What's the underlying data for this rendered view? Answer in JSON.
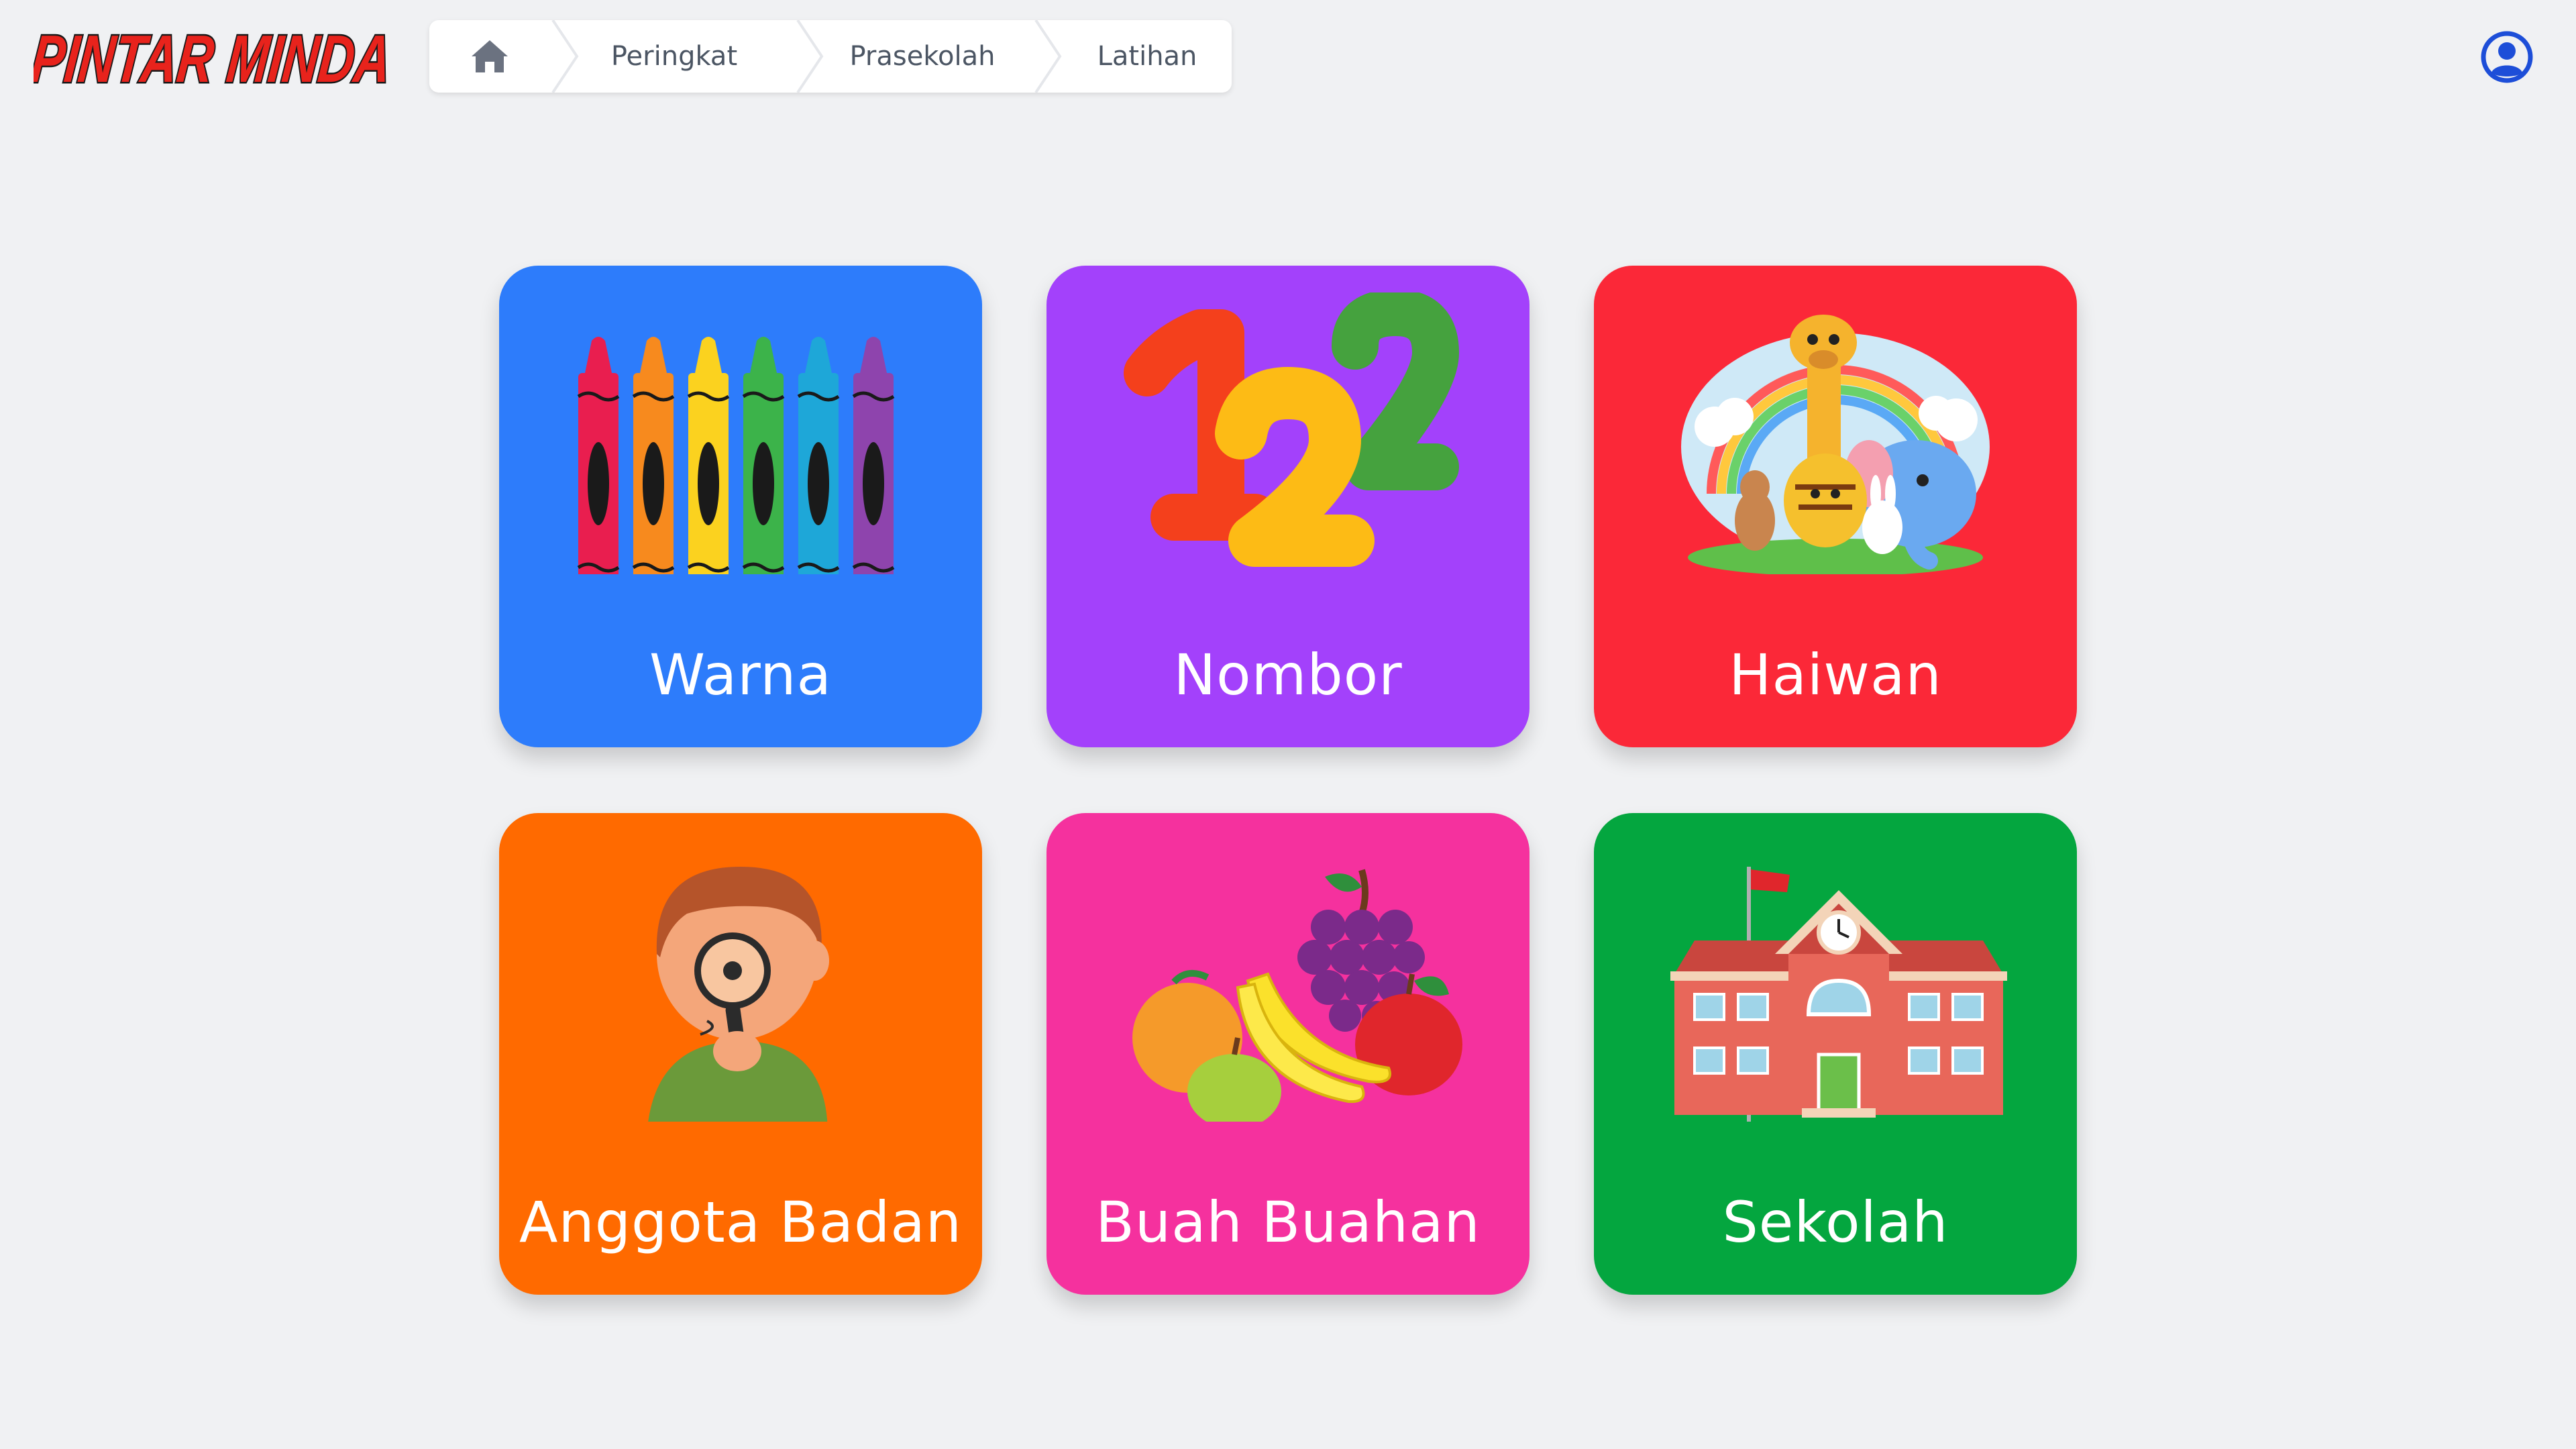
{
  "header": {
    "logo_text": "PINTAR MINDA",
    "breadcrumb": [
      {
        "label": "Peringkat"
      },
      {
        "label": "Prasekolah"
      },
      {
        "label": "Latihan"
      }
    ]
  },
  "tiles": [
    {
      "label": "Warna",
      "color": "#2d7cfb"
    },
    {
      "label": "Nombor",
      "color": "#a341fb"
    },
    {
      "label": "Haiwan",
      "color": "#fb2838"
    },
    {
      "label": "Anggota Badan",
      "color": "#ff6a00"
    },
    {
      "label": "Buah Buahan",
      "color": "#f5319e"
    },
    {
      "label": "Sekolah",
      "color": "#04a63f"
    }
  ],
  "icons": [
    "home-icon",
    "user-icon",
    "crayons-icon",
    "numbers-123-icon",
    "animals-icon",
    "boy-magnifier-icon",
    "fruits-icon",
    "school-building-icon"
  ]
}
